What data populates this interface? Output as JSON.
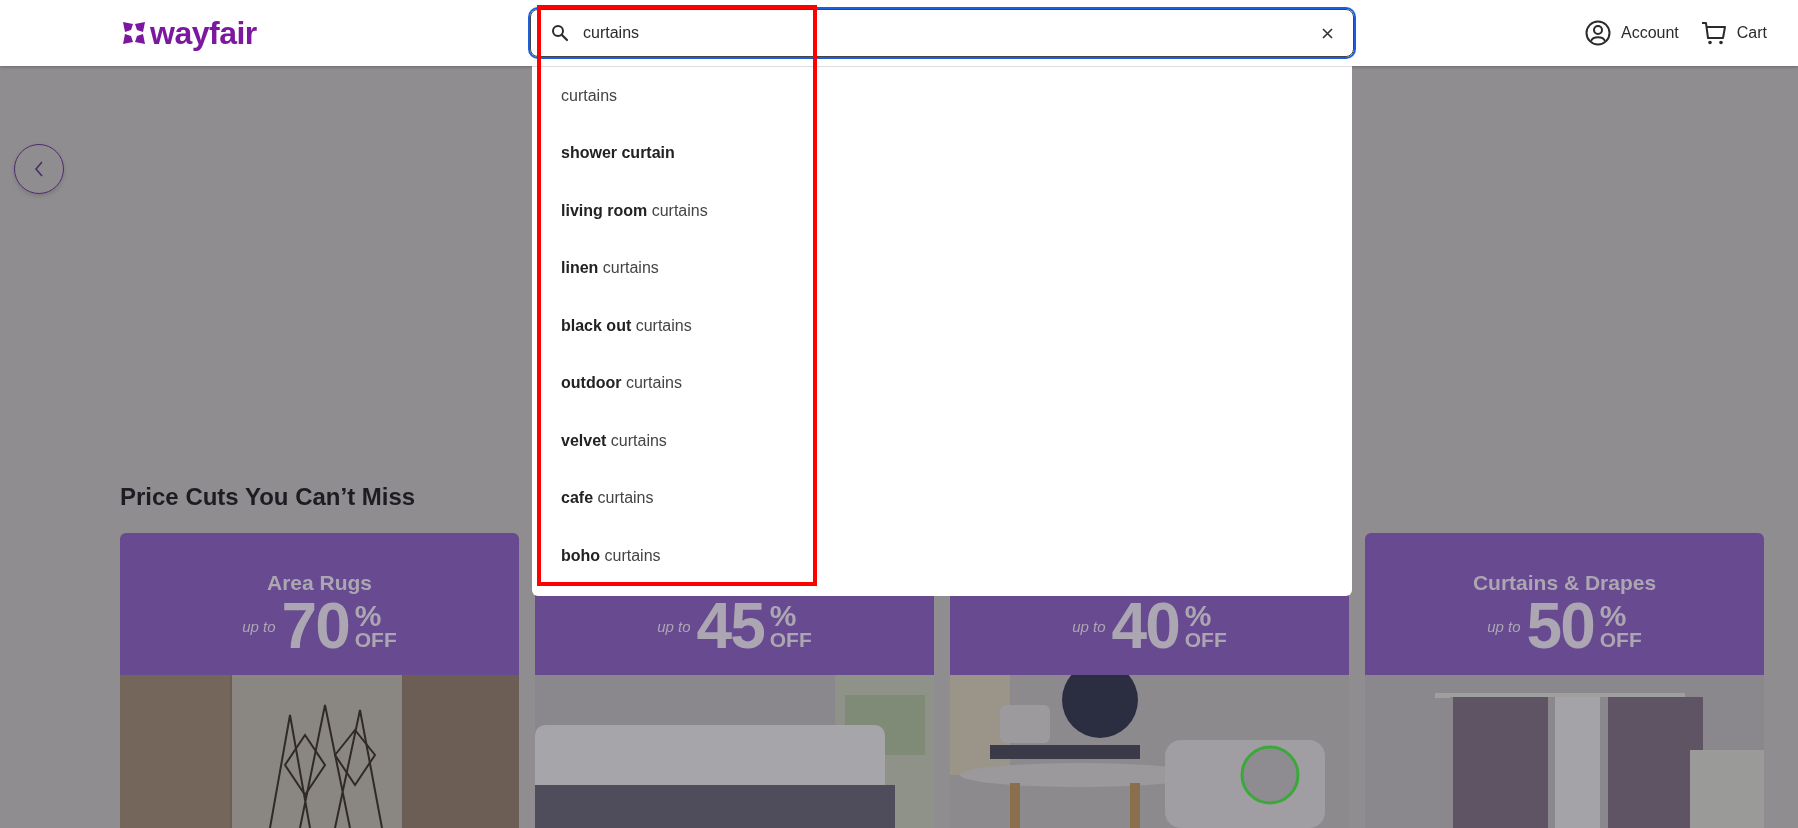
{
  "header": {
    "logo": "wayfair",
    "search": {
      "value": "curtains"
    },
    "account": "Account",
    "cart": "Cart"
  },
  "suggestions": [
    {
      "rest": "curtains"
    },
    {
      "match": "shower curtain"
    },
    {
      "match": "living room",
      "rest": "curtains"
    },
    {
      "match": "linen",
      "rest": "curtains"
    },
    {
      "match": "black out",
      "rest": "curtains"
    },
    {
      "match": "outdoor",
      "rest": "curtains"
    },
    {
      "match": "velvet",
      "rest": "curtains"
    },
    {
      "match": "cafe",
      "rest": "curtains"
    },
    {
      "match": "boho",
      "rest": "curtains"
    }
  ],
  "section": {
    "title": "Price Cuts You Can’t Miss",
    "cards": [
      {
        "title": "Area Rugs",
        "prefix": "up to",
        "amount": "70",
        "percent": "%",
        "off": "OFF"
      },
      {
        "prefix": "up to",
        "amount": "45",
        "percent": "%",
        "off": "OFF"
      },
      {
        "prefix": "up to",
        "amount": "40",
        "percent": "%",
        "off": "OFF"
      },
      {
        "title": "Curtains & Drapes",
        "prefix": "up to",
        "amount": "50",
        "percent": "%",
        "off": "OFF"
      }
    ]
  }
}
